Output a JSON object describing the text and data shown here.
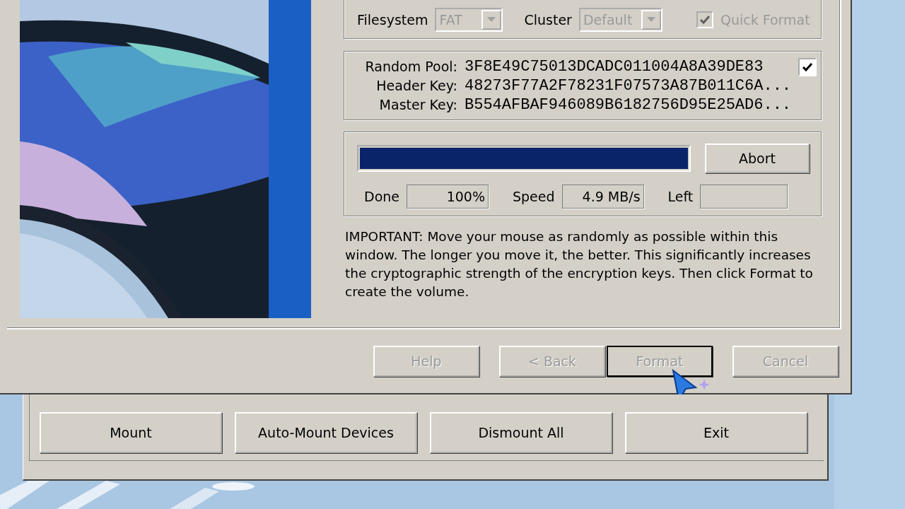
{
  "format_options": {
    "filesystem": {
      "label": "Filesystem",
      "value": "FAT",
      "disabled": true
    },
    "cluster": {
      "label": "Cluster",
      "value": "Default",
      "disabled": true
    },
    "quick_format": {
      "label": "Quick Format",
      "checked": true,
      "disabled": true
    }
  },
  "keys": {
    "show_checked": true,
    "rows": [
      {
        "label": "Random Pool:",
        "value": "3F8E49C75013DCADC011004A8A39DE83"
      },
      {
        "label": "Header Key:",
        "value": "48273F77A2F78231F07573A87B011C6A..."
      },
      {
        "label": "Master Key:",
        "value": "B554AFBAF946089B6182756D95E25AD6..."
      }
    ]
  },
  "progress": {
    "level": 1,
    "abort_label": "Abort",
    "fields": [
      {
        "label": "Done",
        "value": "100%"
      },
      {
        "label": "Speed",
        "value": "4.9 MB/s"
      },
      {
        "label": "Left"
      }
    ]
  },
  "notice": "IMPORTANT: Move your mouse as randomly as possible within this window. The longer you move it, the better. This significantly increases the cryptographic strength of the encryption keys. Then click Format to create the volume.",
  "wizard_buttons": [
    {
      "label": "Help",
      "disabled": true,
      "default": false
    },
    {
      "label": "< Back",
      "disabled": true,
      "default": false
    },
    {
      "label": "Format",
      "disabled": true,
      "default": true
    },
    {
      "label": "Cancel",
      "disabled": true,
      "default": false
    }
  ],
  "main_buttons": [
    {
      "label": "Mount"
    },
    {
      "label": "Auto-Mount Devices"
    },
    {
      "label": "Dismount All"
    },
    {
      "label": "Exit"
    }
  ]
}
